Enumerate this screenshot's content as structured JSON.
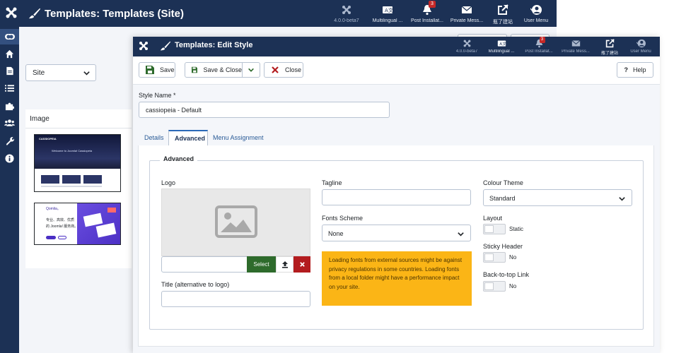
{
  "background": {
    "app_title": "Templates: Templates (Site)",
    "header_items": [
      {
        "label": "4.0.0-beta7",
        "icon": "joomla-icon",
        "dim": true
      },
      {
        "label": "Multilingual ...",
        "icon": "language-icon",
        "dim": false
      },
      {
        "label": "Post Installat...",
        "icon": "bell-icon",
        "badge": "3",
        "dim": false
      },
      {
        "label": "Private Mess...",
        "icon": "envelope-icon",
        "dim": false
      },
      {
        "label": "瓶了建站",
        "icon": "external-link-icon",
        "dim": false
      },
      {
        "label": "User Menu",
        "icon": "user-icon",
        "dim": false
      }
    ],
    "sidebar_items": [
      "toggle-icon",
      "home-icon",
      "file-icon",
      "list-icon",
      "puzzle-icon",
      "users-icon",
      "wrench-icon",
      "info-icon"
    ],
    "site_filter": {
      "value": "Site"
    },
    "image_panel": {
      "header": "Image",
      "thumb1": {
        "brand": "CASSIOPEIA",
        "headline": "Welcome to Joomla! Cassiopeia"
      },
      "thumb2": {
        "line1": "Qomlia。",
        "line2": "专业、高效、优质",
        "line3": "的 Joomla! 服务商。"
      }
    }
  },
  "dialog": {
    "title": "Templates: Edit Style",
    "header_items": [
      {
        "label": "4.0.0-beta7",
        "icon": "joomla-icon",
        "dim": true
      },
      {
        "label": "Multilingual ...",
        "icon": "language-icon",
        "dim": false
      },
      {
        "label": "Post Installat...",
        "icon": "bell-icon",
        "badge": "3",
        "dim": true
      },
      {
        "label": "Private Mess...",
        "icon": "envelope-icon",
        "dim": true
      },
      {
        "label": "瓶了建站",
        "icon": "external-link-icon",
        "dim": false
      },
      {
        "label": "User Menu",
        "icon": "user-icon",
        "dim": true
      }
    ],
    "toolbar": {
      "save": "Save",
      "save_close": "Save & Close",
      "close": "Close",
      "help": "Help"
    },
    "style_name": {
      "label": "Style Name *",
      "value": "cassiopeia - Default"
    },
    "tabs": [
      "Details",
      "Advanced",
      "Menu Assignment"
    ],
    "active_tab": "Advanced",
    "fieldset_legend": "Advanced",
    "logo": {
      "label": "Logo",
      "select": "Select"
    },
    "title_alt": {
      "label": "Title (alternative to logo)",
      "value": ""
    },
    "tagline": {
      "label": "Tagline",
      "value": ""
    },
    "fonts_scheme": {
      "label": "Fonts Scheme",
      "value": "None"
    },
    "fonts_warning": "Loading fonts from external sources might be against privacy regulations in some countries. Loading fonts from a local folder might have a performance impact on your site.",
    "colour_theme": {
      "label": "Colour Theme",
      "value": "Standard"
    },
    "layout": {
      "label": "Layout",
      "value": "Static"
    },
    "sticky_header": {
      "label": "Sticky Header",
      "value": "No"
    },
    "back_to_top": {
      "label": "Back-to-top Link",
      "value": "No"
    }
  },
  "colors": {
    "header_bg": "#1c3155",
    "save_green": "#2e6b2c",
    "danger_red": "#b31c1f",
    "warning_yellow": "#fbb516",
    "link_blue": "#2a5b97"
  }
}
